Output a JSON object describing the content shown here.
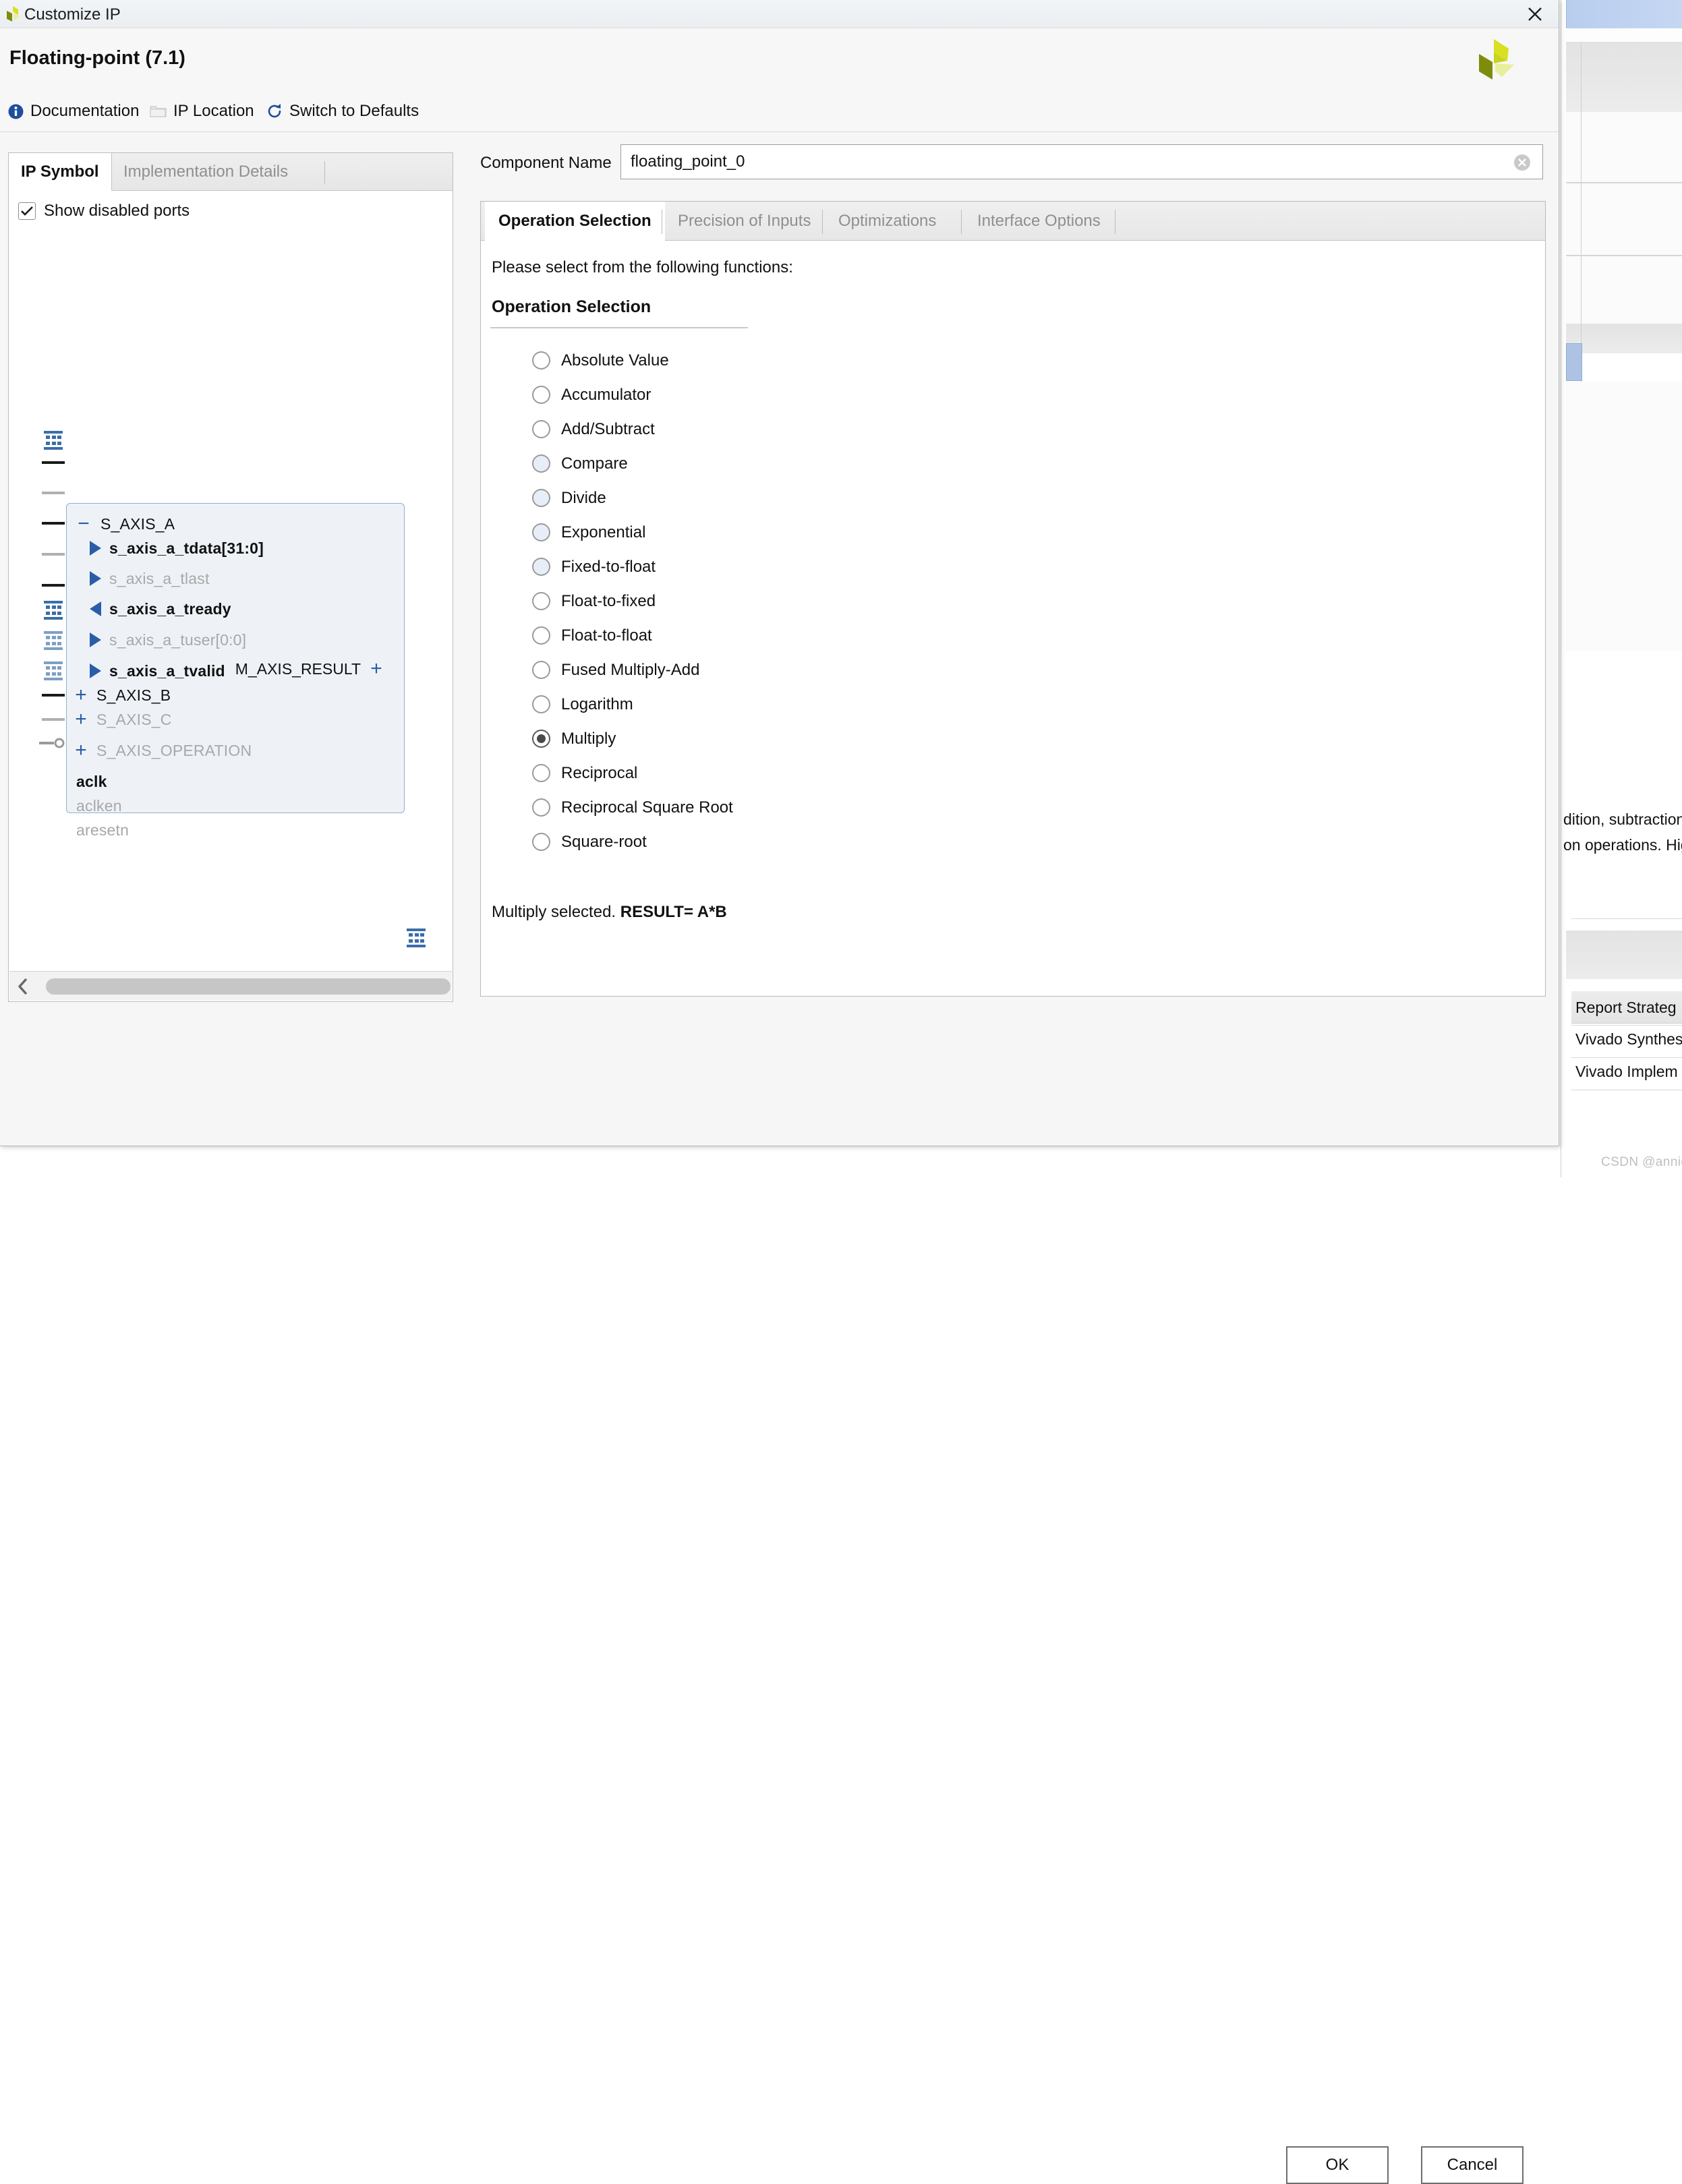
{
  "window": {
    "title": "Customize IP",
    "close_icon": "close-icon",
    "app_icon": "xilinx-vivado-icon"
  },
  "header": {
    "title": "Floating-point (7.1)",
    "logo_icon": "xilinx-logo-icon"
  },
  "toolbar": {
    "links": [
      {
        "label": "Documentation",
        "icon": "info-icon"
      },
      {
        "label": "IP Location",
        "icon": "folder-icon"
      },
      {
        "label": "Switch to Defaults",
        "icon": "refresh-icon"
      }
    ]
  },
  "left_panel": {
    "tabs": [
      {
        "label": "IP Symbol",
        "active": true
      },
      {
        "label": "Implementation Details",
        "active": false
      }
    ],
    "show_disabled_ports": {
      "label": "Show disabled ports",
      "checked": true,
      "icon": "checkmark-icon"
    },
    "symbol": {
      "ports": [
        {
          "label": "S_AXIS_A",
          "kind": "bus",
          "sign": "−",
          "enabled": true,
          "bold": false,
          "stub": "bus"
        },
        {
          "label": "s_axis_a_tdata[31:0]",
          "kind": "in",
          "enabled": true,
          "bold": true,
          "stub": "on"
        },
        {
          "label": "s_axis_a_tlast",
          "kind": "in",
          "enabled": false,
          "bold": false,
          "stub": "off"
        },
        {
          "label": "s_axis_a_tready",
          "kind": "out",
          "enabled": true,
          "bold": true,
          "stub": "on"
        },
        {
          "label": "s_axis_a_tuser[0:0]",
          "kind": "in",
          "enabled": false,
          "bold": false,
          "stub": "off"
        },
        {
          "label": "s_axis_a_tvalid",
          "kind": "in",
          "enabled": true,
          "bold": true,
          "stub": "on"
        },
        {
          "label": "S_AXIS_B",
          "kind": "bus",
          "sign": "+",
          "enabled": true,
          "bold": false,
          "stub": "bus"
        },
        {
          "label": "S_AXIS_C",
          "kind": "bus",
          "sign": "+",
          "enabled": false,
          "bold": false,
          "stub": "bus"
        },
        {
          "label": "S_AXIS_OPERATION",
          "kind": "bus",
          "sign": "+",
          "enabled": false,
          "bold": false,
          "stub": "bus"
        },
        {
          "label": "aclk",
          "kind": "plain",
          "enabled": true,
          "bold": true,
          "stub": "on"
        },
        {
          "label": "aclken",
          "kind": "plain",
          "enabled": false,
          "bold": false,
          "stub": "off"
        },
        {
          "label": "aresetn",
          "kind": "plain-inv",
          "enabled": false,
          "bold": false,
          "stub": "inv"
        }
      ],
      "output_port": {
        "label": "M_AXIS_RESULT",
        "sign": "+"
      }
    },
    "scrollbar": {
      "left_icon": "chevron-left-icon",
      "right_icon": "chevron-right-icon"
    }
  },
  "right_panel": {
    "component_name": {
      "label": "Component Name",
      "value": "floating_point_0",
      "placeholder": "floating_point_0",
      "clear_icon": "clear-circle-icon"
    },
    "tabs": [
      {
        "label": "Operation Selection",
        "active": true
      },
      {
        "label": "Precision of Inputs",
        "active": false
      },
      {
        "label": "Optimizations",
        "active": false
      },
      {
        "label": "Interface Options",
        "active": false
      }
    ],
    "intro_text": "Please select from the following functions:",
    "group_title": "Operation Selection",
    "operations": [
      {
        "label": "Absolute Value",
        "checked": false,
        "tinted": false
      },
      {
        "label": "Accumulator",
        "checked": false,
        "tinted": false
      },
      {
        "label": "Add/Subtract",
        "checked": false,
        "tinted": false
      },
      {
        "label": "Compare",
        "checked": false,
        "tinted": true
      },
      {
        "label": "Divide",
        "checked": false,
        "tinted": true
      },
      {
        "label": "Exponential",
        "checked": false,
        "tinted": true
      },
      {
        "label": "Fixed-to-float",
        "checked": false,
        "tinted": true
      },
      {
        "label": "Float-to-fixed",
        "checked": false,
        "tinted": false
      },
      {
        "label": "Float-to-float",
        "checked": false,
        "tinted": false
      },
      {
        "label": "Fused Multiply-Add",
        "checked": false,
        "tinted": false
      },
      {
        "label": "Logarithm",
        "checked": false,
        "tinted": false
      },
      {
        "label": "Multiply",
        "checked": true,
        "tinted": false
      },
      {
        "label": "Reciprocal",
        "checked": false,
        "tinted": false
      },
      {
        "label": "Reciprocal Square Root",
        "checked": false,
        "tinted": false
      },
      {
        "label": "Square-root",
        "checked": false,
        "tinted": false
      }
    ],
    "status_prefix": "Multiply selected. ",
    "status_bold": "RESULT= A*B"
  },
  "footer": {
    "ok_label": "OK",
    "cancel_label": "Cancel"
  },
  "background": {
    "description_line1": "dition, subtraction",
    "description_line2": "on operations. Hig",
    "report_rows": [
      "Report Strateg",
      "Vivado Synthes",
      "Vivado Implem"
    ]
  },
  "watermark": "CSDN @anniezfy",
  "colors": {
    "accent_blue": "#2a5da8",
    "block_fill": "#eef2f7",
    "block_border": "#8fb0d4",
    "logo_green": "#cddc2a"
  }
}
